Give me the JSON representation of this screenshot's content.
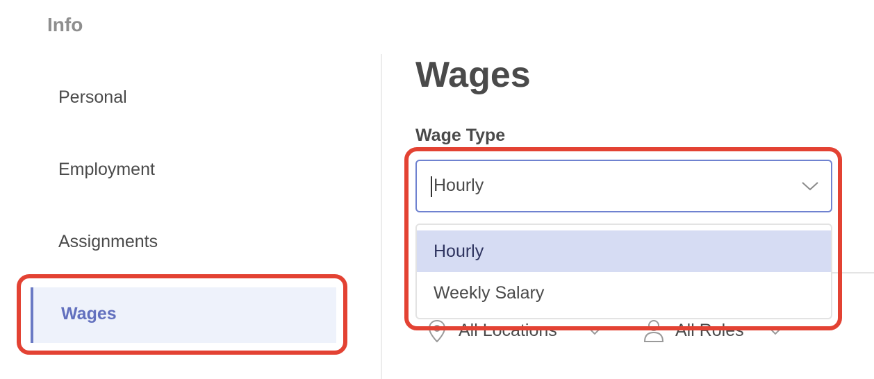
{
  "header": {
    "info_title": "Info"
  },
  "sidebar": {
    "items": [
      {
        "label": "Personal"
      },
      {
        "label": "Employment"
      },
      {
        "label": "Assignments"
      },
      {
        "label": "Wages"
      }
    ],
    "active_index": 3
  },
  "main": {
    "title": "Wages",
    "wage_type": {
      "label": "Wage Type",
      "value": "Hourly",
      "options": [
        "Hourly",
        "Weekly Salary"
      ],
      "selected_option": "Hourly"
    },
    "filters": {
      "locations_label": "All Locations",
      "roles_label": "All Roles"
    }
  },
  "colors": {
    "accent": "#6270be",
    "highlight_border": "#e34233",
    "selected_option_bg": "#d6dcf3",
    "active_sidebar_bg": "#eef2fb"
  },
  "icons": {
    "dropdown_chevron": "chevron-down-icon",
    "location": "location-pin-icon",
    "roles": "person-icon"
  }
}
